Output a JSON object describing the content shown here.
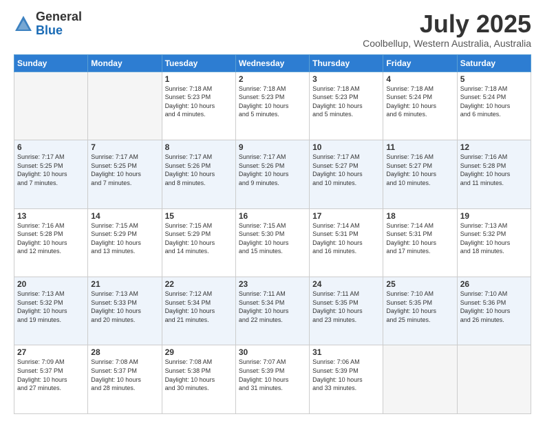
{
  "header": {
    "logo_general": "General",
    "logo_blue": "Blue",
    "month_year": "July 2025",
    "location": "Coolbellup, Western Australia, Australia"
  },
  "weekdays": [
    "Sunday",
    "Monday",
    "Tuesday",
    "Wednesday",
    "Thursday",
    "Friday",
    "Saturday"
  ],
  "weeks": [
    [
      {
        "day": "",
        "info": ""
      },
      {
        "day": "",
        "info": ""
      },
      {
        "day": "1",
        "info": "Sunrise: 7:18 AM\nSunset: 5:23 PM\nDaylight: 10 hours\nand 4 minutes."
      },
      {
        "day": "2",
        "info": "Sunrise: 7:18 AM\nSunset: 5:23 PM\nDaylight: 10 hours\nand 5 minutes."
      },
      {
        "day": "3",
        "info": "Sunrise: 7:18 AM\nSunset: 5:23 PM\nDaylight: 10 hours\nand 5 minutes."
      },
      {
        "day": "4",
        "info": "Sunrise: 7:18 AM\nSunset: 5:24 PM\nDaylight: 10 hours\nand 6 minutes."
      },
      {
        "day": "5",
        "info": "Sunrise: 7:18 AM\nSunset: 5:24 PM\nDaylight: 10 hours\nand 6 minutes."
      }
    ],
    [
      {
        "day": "6",
        "info": "Sunrise: 7:17 AM\nSunset: 5:25 PM\nDaylight: 10 hours\nand 7 minutes."
      },
      {
        "day": "7",
        "info": "Sunrise: 7:17 AM\nSunset: 5:25 PM\nDaylight: 10 hours\nand 7 minutes."
      },
      {
        "day": "8",
        "info": "Sunrise: 7:17 AM\nSunset: 5:26 PM\nDaylight: 10 hours\nand 8 minutes."
      },
      {
        "day": "9",
        "info": "Sunrise: 7:17 AM\nSunset: 5:26 PM\nDaylight: 10 hours\nand 9 minutes."
      },
      {
        "day": "10",
        "info": "Sunrise: 7:17 AM\nSunset: 5:27 PM\nDaylight: 10 hours\nand 10 minutes."
      },
      {
        "day": "11",
        "info": "Sunrise: 7:16 AM\nSunset: 5:27 PM\nDaylight: 10 hours\nand 10 minutes."
      },
      {
        "day": "12",
        "info": "Sunrise: 7:16 AM\nSunset: 5:28 PM\nDaylight: 10 hours\nand 11 minutes."
      }
    ],
    [
      {
        "day": "13",
        "info": "Sunrise: 7:16 AM\nSunset: 5:28 PM\nDaylight: 10 hours\nand 12 minutes."
      },
      {
        "day": "14",
        "info": "Sunrise: 7:15 AM\nSunset: 5:29 PM\nDaylight: 10 hours\nand 13 minutes."
      },
      {
        "day": "15",
        "info": "Sunrise: 7:15 AM\nSunset: 5:29 PM\nDaylight: 10 hours\nand 14 minutes."
      },
      {
        "day": "16",
        "info": "Sunrise: 7:15 AM\nSunset: 5:30 PM\nDaylight: 10 hours\nand 15 minutes."
      },
      {
        "day": "17",
        "info": "Sunrise: 7:14 AM\nSunset: 5:31 PM\nDaylight: 10 hours\nand 16 minutes."
      },
      {
        "day": "18",
        "info": "Sunrise: 7:14 AM\nSunset: 5:31 PM\nDaylight: 10 hours\nand 17 minutes."
      },
      {
        "day": "19",
        "info": "Sunrise: 7:13 AM\nSunset: 5:32 PM\nDaylight: 10 hours\nand 18 minutes."
      }
    ],
    [
      {
        "day": "20",
        "info": "Sunrise: 7:13 AM\nSunset: 5:32 PM\nDaylight: 10 hours\nand 19 minutes."
      },
      {
        "day": "21",
        "info": "Sunrise: 7:13 AM\nSunset: 5:33 PM\nDaylight: 10 hours\nand 20 minutes."
      },
      {
        "day": "22",
        "info": "Sunrise: 7:12 AM\nSunset: 5:34 PM\nDaylight: 10 hours\nand 21 minutes."
      },
      {
        "day": "23",
        "info": "Sunrise: 7:11 AM\nSunset: 5:34 PM\nDaylight: 10 hours\nand 22 minutes."
      },
      {
        "day": "24",
        "info": "Sunrise: 7:11 AM\nSunset: 5:35 PM\nDaylight: 10 hours\nand 23 minutes."
      },
      {
        "day": "25",
        "info": "Sunrise: 7:10 AM\nSunset: 5:35 PM\nDaylight: 10 hours\nand 25 minutes."
      },
      {
        "day": "26",
        "info": "Sunrise: 7:10 AM\nSunset: 5:36 PM\nDaylight: 10 hours\nand 26 minutes."
      }
    ],
    [
      {
        "day": "27",
        "info": "Sunrise: 7:09 AM\nSunset: 5:37 PM\nDaylight: 10 hours\nand 27 minutes."
      },
      {
        "day": "28",
        "info": "Sunrise: 7:08 AM\nSunset: 5:37 PM\nDaylight: 10 hours\nand 28 minutes."
      },
      {
        "day": "29",
        "info": "Sunrise: 7:08 AM\nSunset: 5:38 PM\nDaylight: 10 hours\nand 30 minutes."
      },
      {
        "day": "30",
        "info": "Sunrise: 7:07 AM\nSunset: 5:39 PM\nDaylight: 10 hours\nand 31 minutes."
      },
      {
        "day": "31",
        "info": "Sunrise: 7:06 AM\nSunset: 5:39 PM\nDaylight: 10 hours\nand 33 minutes."
      },
      {
        "day": "",
        "info": ""
      },
      {
        "day": "",
        "info": ""
      }
    ]
  ]
}
